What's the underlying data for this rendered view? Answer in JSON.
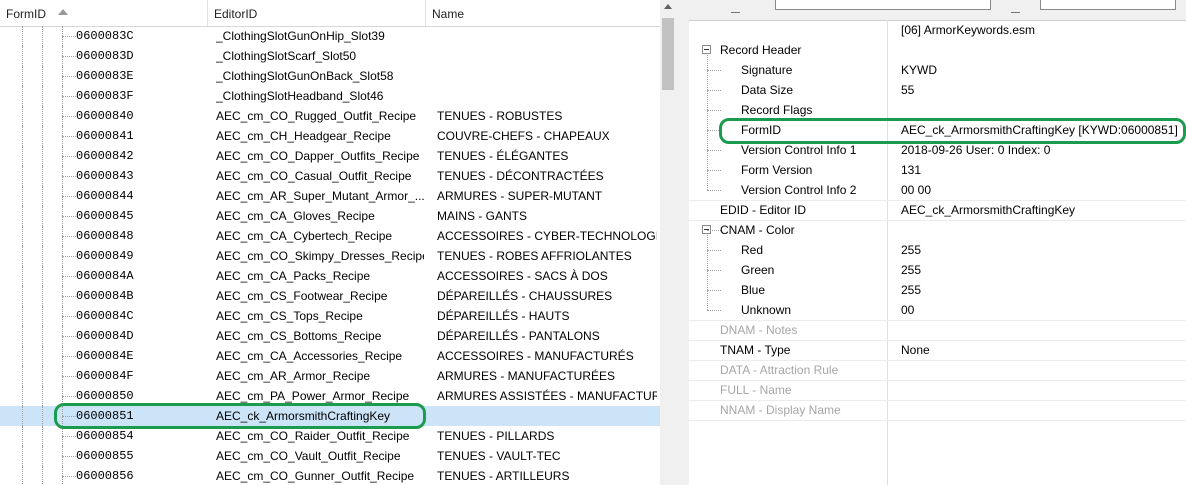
{
  "left_panel": {
    "columns": [
      "FormID",
      "EditorID",
      "Name"
    ],
    "rows": [
      {
        "form_id": "0600083C",
        "editor_id": "_ClothingSlotGunOnHip_Slot39",
        "name": ""
      },
      {
        "form_id": "0600083D",
        "editor_id": "_ClothingSlotScarf_Slot50",
        "name": ""
      },
      {
        "form_id": "0600083E",
        "editor_id": "_ClothingSlotGunOnBack_Slot58",
        "name": ""
      },
      {
        "form_id": "0600083F",
        "editor_id": "_ClothingSlotHeadband_Slot46",
        "name": ""
      },
      {
        "form_id": "06000840",
        "editor_id": "AEC_cm_CO_Rugged_Outfit_Recipe",
        "name": "TENUES - ROBUSTES"
      },
      {
        "form_id": "06000841",
        "editor_id": "AEC_cm_CH_Headgear_Recipe",
        "name": "COUVRE-CHEFS - CHAPEAUX"
      },
      {
        "form_id": "06000842",
        "editor_id": "AEC_cm_CO_Dapper_Outfits_Recipe",
        "name": "TENUES - ÉLÉGANTES"
      },
      {
        "form_id": "06000843",
        "editor_id": "AEC_cm_CO_Casual_Outfit_Recipe",
        "name": "TENUES - DÉCONTRACTÉES"
      },
      {
        "form_id": "06000844",
        "editor_id": "AEC_cm_AR_Super_Mutant_Armor_...",
        "name": "ARMURES - SUPER-MUTANT"
      },
      {
        "form_id": "06000845",
        "editor_id": "AEC_cm_CA_Gloves_Recipe",
        "name": "MAINS - GANTS"
      },
      {
        "form_id": "06000848",
        "editor_id": "AEC_cm_CA_Cybertech_Recipe",
        "name": "ACCESSOIRES - CYBER-TECHNOLOGIQ..."
      },
      {
        "form_id": "06000849",
        "editor_id": "AEC_cm_CO_Skimpy_Dresses_Recipe",
        "name": "TENUES - ROBES AFFRIOLANTES"
      },
      {
        "form_id": "0600084A",
        "editor_id": "AEC_cm_CA_Packs_Recipe",
        "name": "ACCESSOIRES - SACS À DOS"
      },
      {
        "form_id": "0600084B",
        "editor_id": "AEC_cm_CS_Footwear_Recipe",
        "name": "DÉPAREILLÉS - CHAUSSURES"
      },
      {
        "form_id": "0600084C",
        "editor_id": "AEC_cm_CS_Tops_Recipe",
        "name": "DÉPAREILLÉS - HAUTS"
      },
      {
        "form_id": "0600084D",
        "editor_id": "AEC_cm_CS_Bottoms_Recipe",
        "name": "DÉPAREILLÉS - PANTALONS"
      },
      {
        "form_id": "0600084E",
        "editor_id": "AEC_cm_CA_Accessories_Recipe",
        "name": "ACCESSOIRES - MANUFACTURÉS"
      },
      {
        "form_id": "0600084F",
        "editor_id": "AEC_cm_AR_Armor_Recipe",
        "name": "ARMURES - MANUFACTURÉES"
      },
      {
        "form_id": "06000850",
        "editor_id": "AEC_cm_PA_Power_Armor_Recipe",
        "name": "ARMURES ASSISTÉES - MANUFACTURÉES"
      },
      {
        "form_id": "06000851",
        "editor_id": "AEC_ck_ArmorsmithCraftingKey",
        "name": "",
        "selected": true
      },
      {
        "form_id": "06000854",
        "editor_id": "AEC_cm_CO_Raider_Outfit_Recipe",
        "name": "TENUES - PILLARDS"
      },
      {
        "form_id": "06000855",
        "editor_id": "AEC_cm_CO_Vault_Outfit_Recipe",
        "name": "TENUES - VAULT-TEC"
      },
      {
        "form_id": "06000856",
        "editor_id": "AEC_cm_CO_Gunner_Outfit_Recipe",
        "name": "TENUES - ARTILLEURS"
      }
    ]
  },
  "right_panel": {
    "file_header": "[06] ArmorKeywords.esm",
    "rows": [
      {
        "label": "Record Header",
        "value": "",
        "group": true
      },
      {
        "label": "Signature",
        "value": "KYWD"
      },
      {
        "label": "Data Size",
        "value": "55"
      },
      {
        "label": "Record Flags",
        "value": ""
      },
      {
        "label": "FormID",
        "value": "AEC_ck_ArmorsmithCraftingKey [KYWD:06000851]"
      },
      {
        "label": "Version Control Info 1",
        "value": "2018-09-26 User: 0 Index: 0"
      },
      {
        "label": "Form Version",
        "value": "131"
      },
      {
        "label": "Version Control Info 2",
        "value": "00 00"
      },
      {
        "label": "EDID - Editor ID",
        "value": "AEC_ck_ArmorsmithCraftingKey"
      },
      {
        "label": "CNAM - Color",
        "value": "",
        "group": true
      },
      {
        "label": "Red",
        "value": "255"
      },
      {
        "label": "Green",
        "value": "255"
      },
      {
        "label": "Blue",
        "value": "255"
      },
      {
        "label": "Unknown",
        "value": "00"
      },
      {
        "label": "DNAM - Notes",
        "value": "",
        "dim": true
      },
      {
        "label": "TNAM - Type",
        "value": "None"
      },
      {
        "label": "DATA - Attraction Rule",
        "value": "",
        "dim": true
      },
      {
        "label": "FULL - Name",
        "value": "",
        "dim": true
      },
      {
        "label": "NNAM - Display Name",
        "value": "",
        "dim": true
      }
    ]
  },
  "colors": {
    "selection": "#cce4f7",
    "highlight_ring": "#1a9c4e",
    "dim_text": "#a6a6a6"
  },
  "icons": [
    "sort-asc-icon",
    "expand-minus-icon",
    "scroll-up-icon"
  ]
}
